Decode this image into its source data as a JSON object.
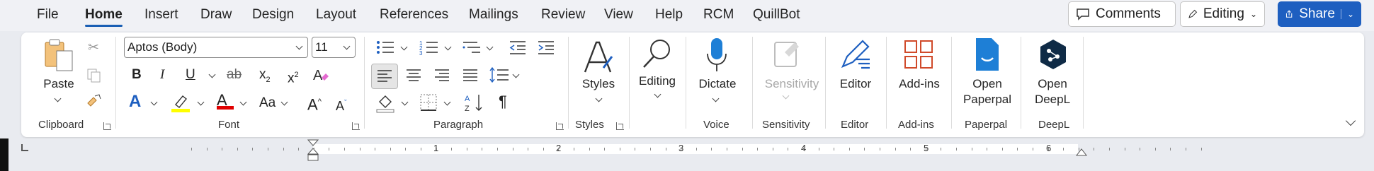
{
  "menu": {
    "tabs": [
      "File",
      "Home",
      "Insert",
      "Draw",
      "Design",
      "Layout",
      "References",
      "Mailings",
      "Review",
      "View",
      "Help",
      "RCM",
      "QuillBot"
    ],
    "active": "Home"
  },
  "top_buttons": {
    "comments": "Comments",
    "editing": "Editing",
    "share": "Share"
  },
  "clipboard": {
    "paste": "Paste",
    "group": "Clipboard"
  },
  "font": {
    "family": "Aptos (Body)",
    "size": "11",
    "group": "Font",
    "bold": "B",
    "italic": "I",
    "underline": "U",
    "strike": "ab",
    "subscript": "x",
    "superscript": "x",
    "case": "Aa",
    "grow": "A",
    "shrink": "A"
  },
  "paragraph": {
    "group": "Paragraph"
  },
  "styles": {
    "label": "Styles",
    "group": "Styles"
  },
  "editing": {
    "label": "Editing"
  },
  "voice": {
    "label": "Dictate",
    "group": "Voice"
  },
  "sensitivity": {
    "label": "Sensitivity",
    "group": "Sensitivity"
  },
  "editor": {
    "label": "Editor",
    "group": "Editor"
  },
  "addins": {
    "label": "Add-ins",
    "group": "Add-ins"
  },
  "paperpal": {
    "label1": "Open",
    "label2": "Paperpal",
    "group": "Paperpal"
  },
  "deepl": {
    "label1": "Open",
    "label2": "DeepL",
    "group": "DeepL"
  },
  "ruler": {
    "numbers": [
      "1",
      "1",
      "2",
      "3",
      "4",
      "5",
      "6"
    ]
  },
  "colors": {
    "accent": "#1e5fc0",
    "highlight": "#ffff00",
    "font_color": "#e00000",
    "addins": "#d04a2a",
    "deepl": "#0f2b46"
  }
}
